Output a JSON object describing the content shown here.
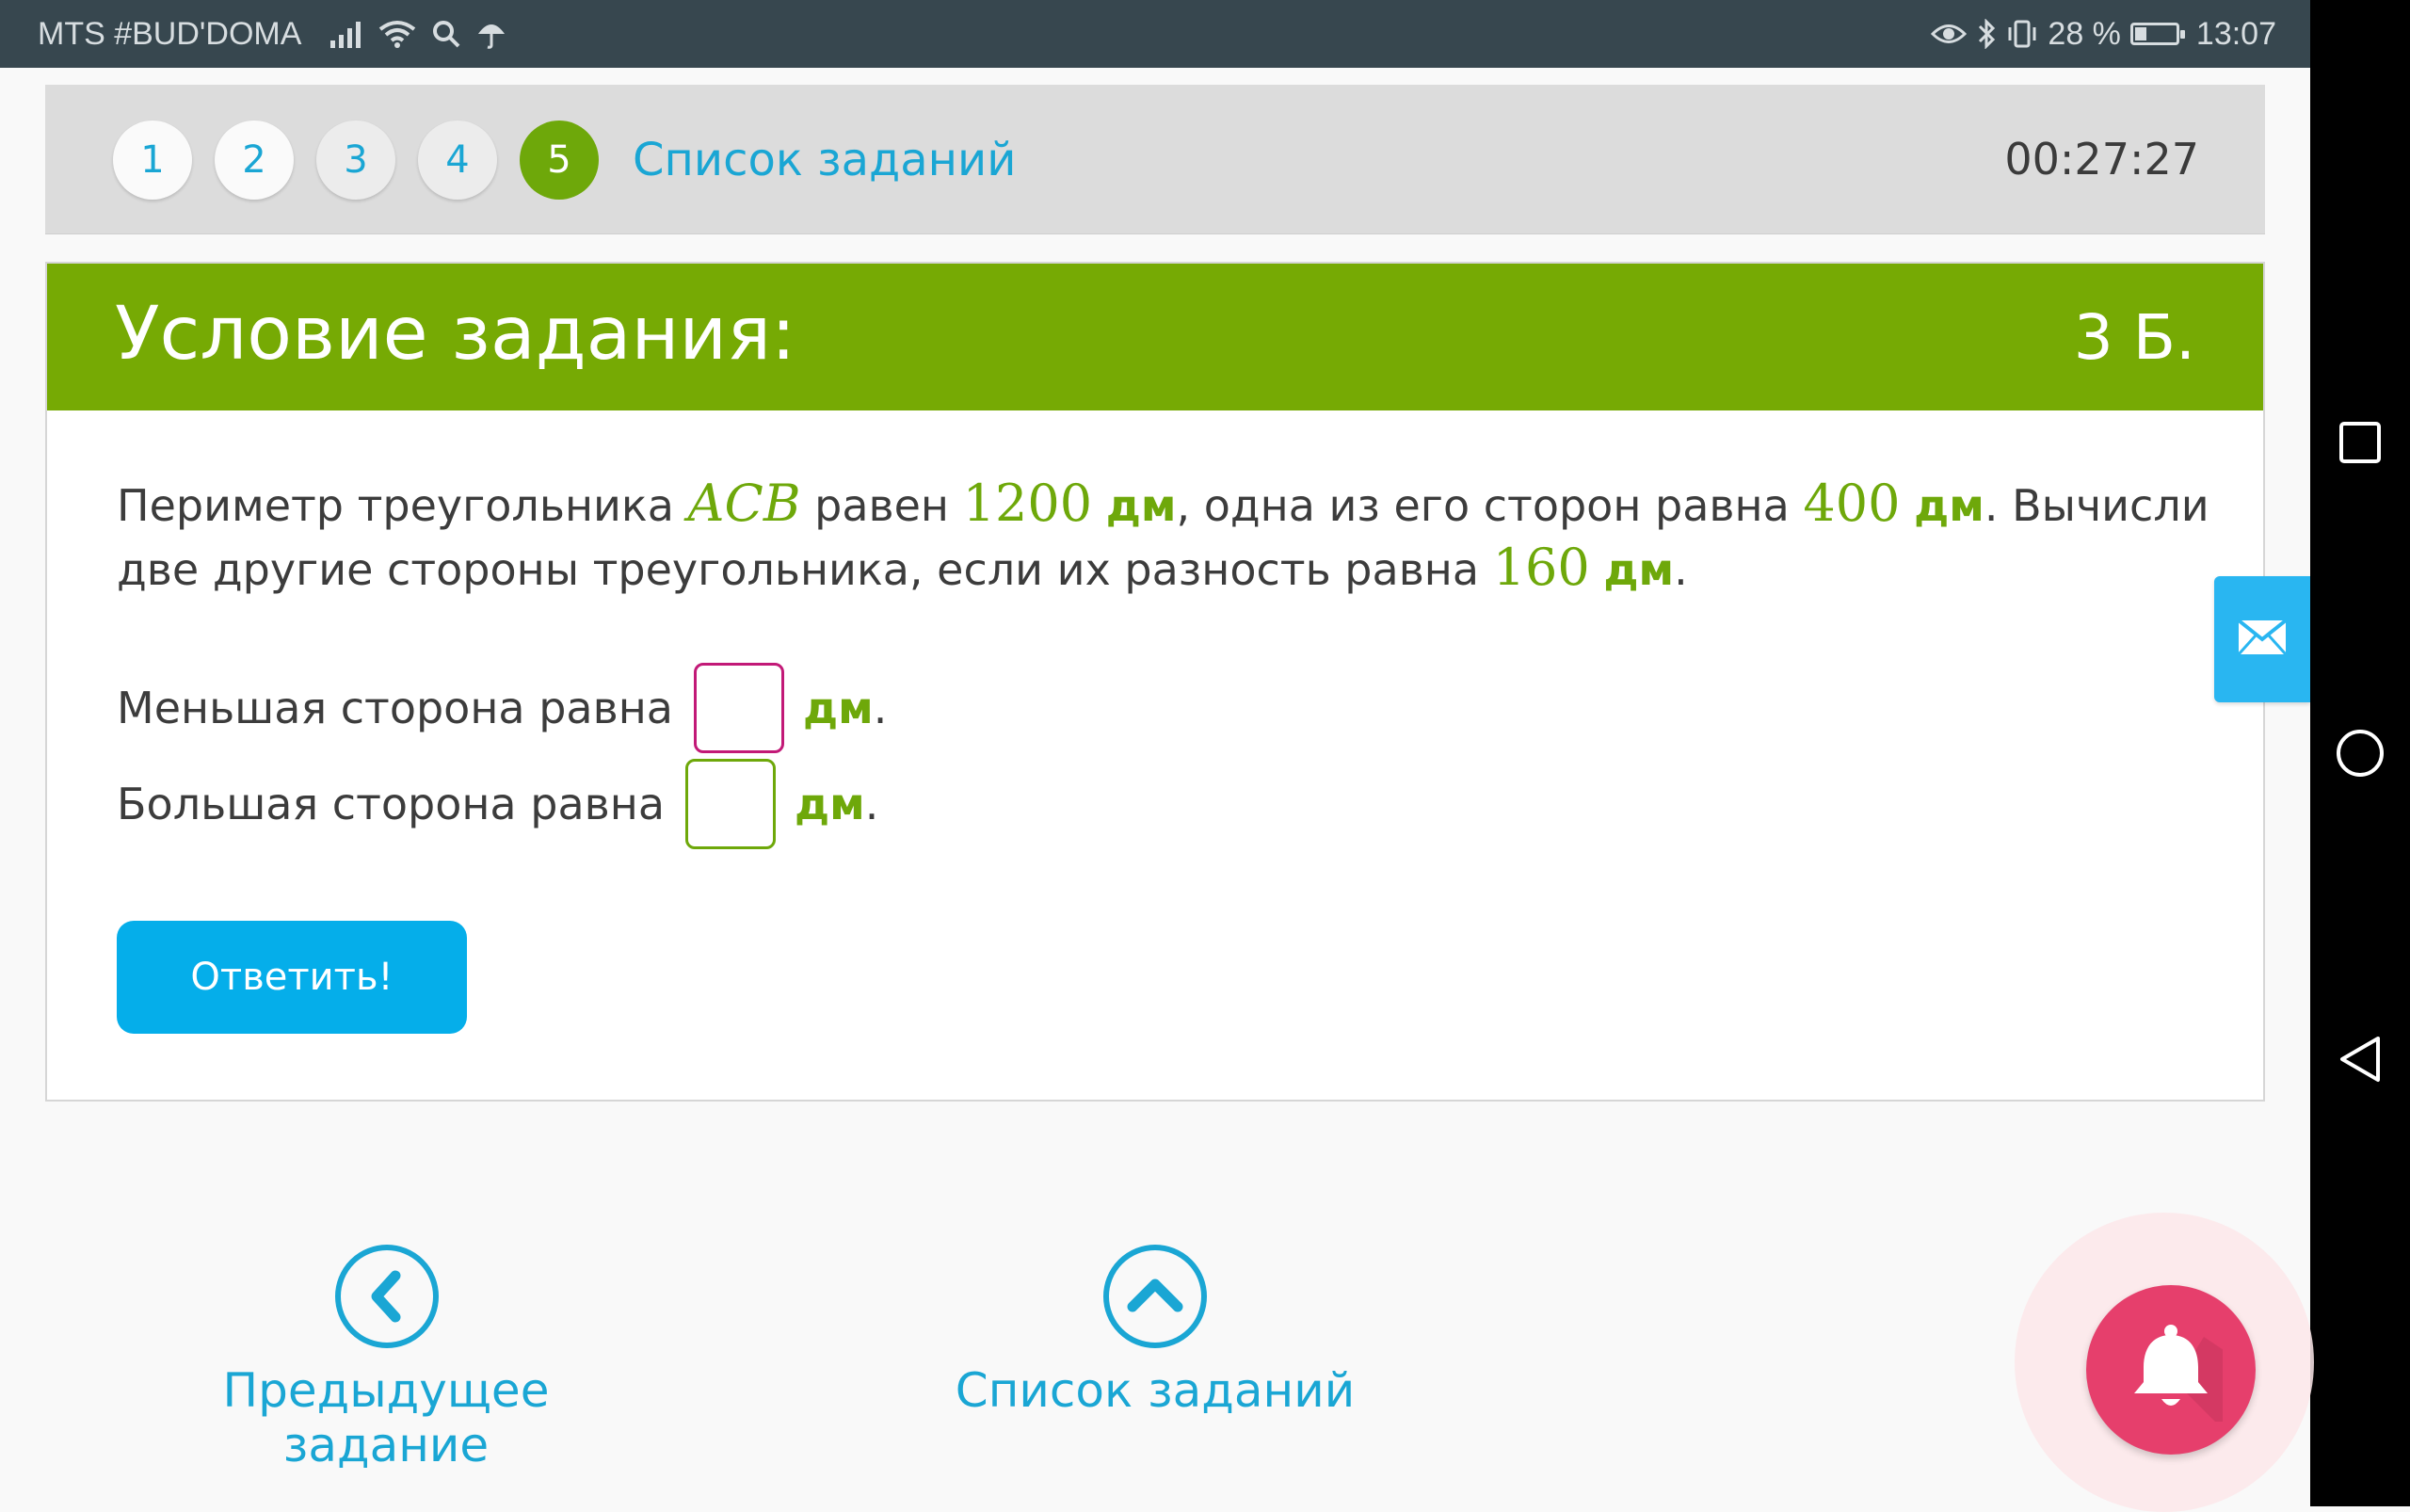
{
  "status_bar": {
    "carrier": "MTS #BUD'DOMA",
    "battery_text": "28 %",
    "battery_level": 0.28,
    "time": "13:07",
    "icons": [
      "signal-icon",
      "wifi-icon",
      "search-icon",
      "umbrella-icon",
      "eye-icon",
      "bluetooth-icon",
      "vibrate-icon",
      "battery-icon"
    ]
  },
  "nav_bar": {
    "icons": [
      "recents-square-icon",
      "home-circle-icon",
      "back-triangle-icon"
    ]
  },
  "tabs": {
    "items": [
      {
        "label": "1"
      },
      {
        "label": "2"
      },
      {
        "label": "3"
      },
      {
        "label": "4"
      },
      {
        "label": "5"
      }
    ],
    "active_index": 4,
    "tasks_link": "Список заданий",
    "timer": "00:27:27"
  },
  "task": {
    "title": "Условие задания:",
    "points": "3 Б.",
    "problem": {
      "t1": "Периметр треугольника ",
      "triangle": "ACB",
      "t2": " равен ",
      "perimeter": "1200",
      "unit": "дм",
      "t3": ", одна из его сторон равна ",
      "side": "400",
      "t4": ". Вычисли две другие стороны треугольника, если их разность равна ",
      "difference": "160",
      "t5": "."
    },
    "answers": [
      {
        "label": "Меньшая сторона равна",
        "value": "",
        "unit": "дм",
        "suffix": "."
      },
      {
        "label": "Большая сторона равна",
        "value": "",
        "unit": "дм",
        "suffix": "."
      }
    ],
    "submit_label": "Ответить!"
  },
  "bottom_nav": {
    "prev_label": "Предыдущее задание",
    "list_label": "Список заданий"
  },
  "colors": {
    "accent_green": "#76aa04",
    "link_blue": "#1aa6d4",
    "button_blue": "#05aeea",
    "bell_pink": "#e63f6c",
    "status_bar": "#37474f"
  }
}
